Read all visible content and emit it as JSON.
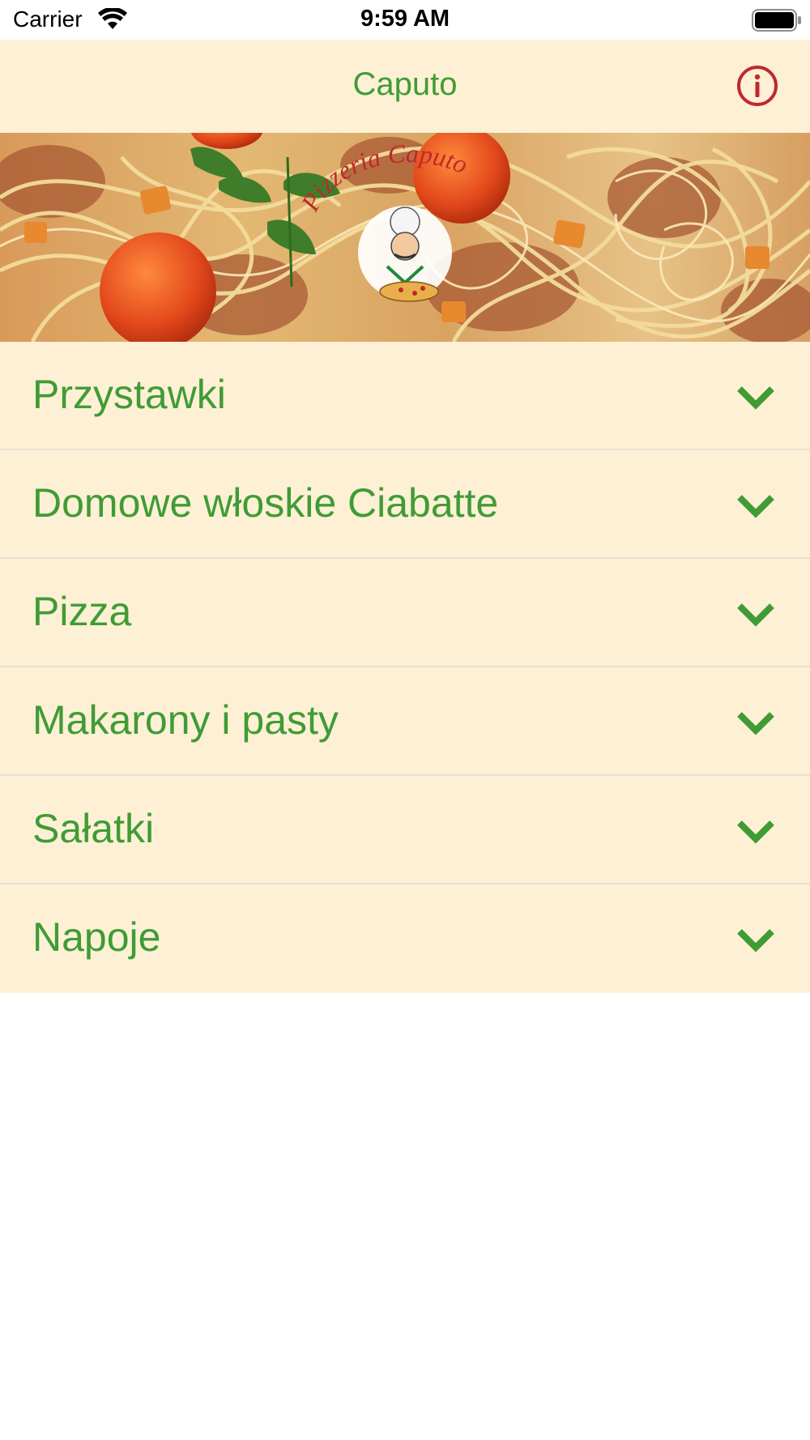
{
  "status_bar": {
    "carrier": "Carrier",
    "time": "9:59 AM",
    "wifi_icon": "wifi-icon",
    "battery_icon": "battery-full-icon"
  },
  "nav": {
    "title": "Caputo",
    "info_icon": "info-circle-icon"
  },
  "hero": {
    "logo_text": "Pizzeria Caputo",
    "description_icon": "pasta-banner-image"
  },
  "categories": [
    {
      "label": "Przystawki",
      "icon": "chevron-down-icon"
    },
    {
      "label": "Domowe włoskie Ciabatte",
      "icon": "chevron-down-icon"
    },
    {
      "label": "Pizza",
      "icon": "chevron-down-icon"
    },
    {
      "label": "Makarony i pasty",
      "icon": "chevron-down-icon"
    },
    {
      "label": "Sałatki",
      "icon": "chevron-down-icon"
    },
    {
      "label": "Napoje",
      "icon": "chevron-down-icon"
    }
  ],
  "colors": {
    "accent_green": "#3f9c35",
    "info_red": "#c0282d",
    "panel_cream": "#fdf0d5"
  }
}
